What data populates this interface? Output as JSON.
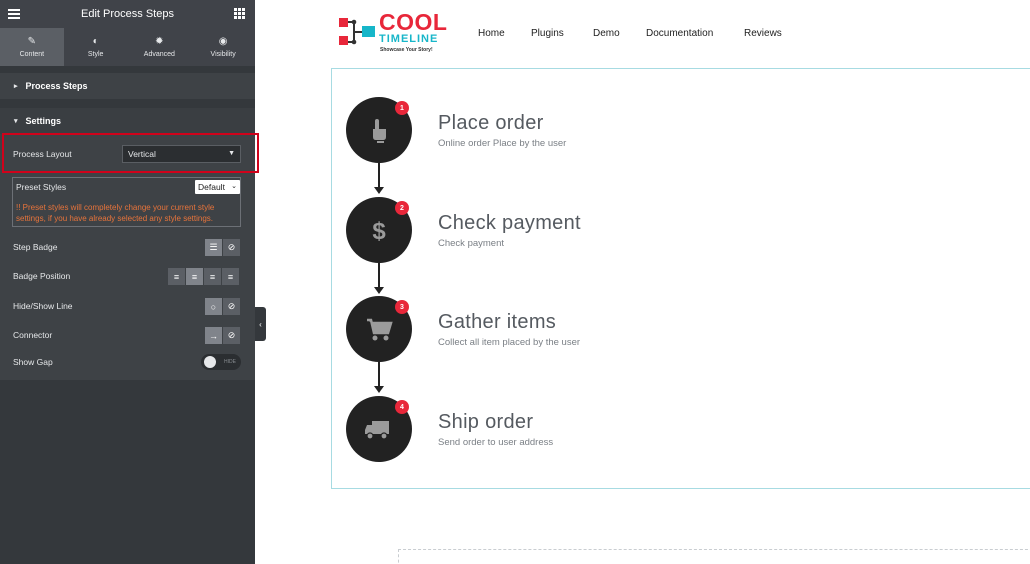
{
  "sidebar": {
    "title": "Edit Process Steps",
    "tabs": [
      {
        "label": "Content",
        "icon": "pencil-icon"
      },
      {
        "label": "Style",
        "icon": "contrast-icon"
      },
      {
        "label": "Advanced",
        "icon": "gear-icon"
      },
      {
        "label": "Visibility",
        "icon": "eye-icon"
      }
    ],
    "sections": {
      "process_steps": "Process Steps",
      "settings": "Settings"
    },
    "controls": {
      "process_layout_label": "Process Layout",
      "process_layout_value": "Vertical",
      "preset_styles_label": "Preset Styles",
      "preset_styles_value": "Default",
      "preset_warning": "!! Preset styles will completely change your current style settings, if you have already selected any style settings.",
      "step_badge_label": "Step Badge",
      "badge_position_label": "Badge Position",
      "hide_show_line_label": "Hide/Show Line",
      "connector_label": "Connector",
      "show_gap_label": "Show Gap",
      "show_gap_toggle_text": "HIDE"
    }
  },
  "header": {
    "logo": {
      "cool": "COOL",
      "timeline": "TIMELINE",
      "tagline": "Showcase Your Story!"
    },
    "nav": [
      "Home",
      "Plugins",
      "Demo",
      "Documentation",
      "Reviews"
    ]
  },
  "steps": [
    {
      "badge": "1",
      "title": "Place order",
      "desc": "Online order Place by the user",
      "icon": "hand-pointer-icon"
    },
    {
      "badge": "2",
      "title": "Check payment",
      "desc": "Check payment",
      "icon": "dollar-icon"
    },
    {
      "badge": "3",
      "title": "Gather items",
      "desc": "Collect all item placed by the user",
      "icon": "shopping-cart-icon"
    },
    {
      "badge": "4",
      "title": "Ship order",
      "desc": "Send order to user address",
      "icon": "truck-icon"
    }
  ],
  "colors": {
    "accent_red": "#e8273a",
    "accent_teal": "#17b6c9",
    "panel_bg": "#34383c",
    "highlight": "#d0021b"
  }
}
